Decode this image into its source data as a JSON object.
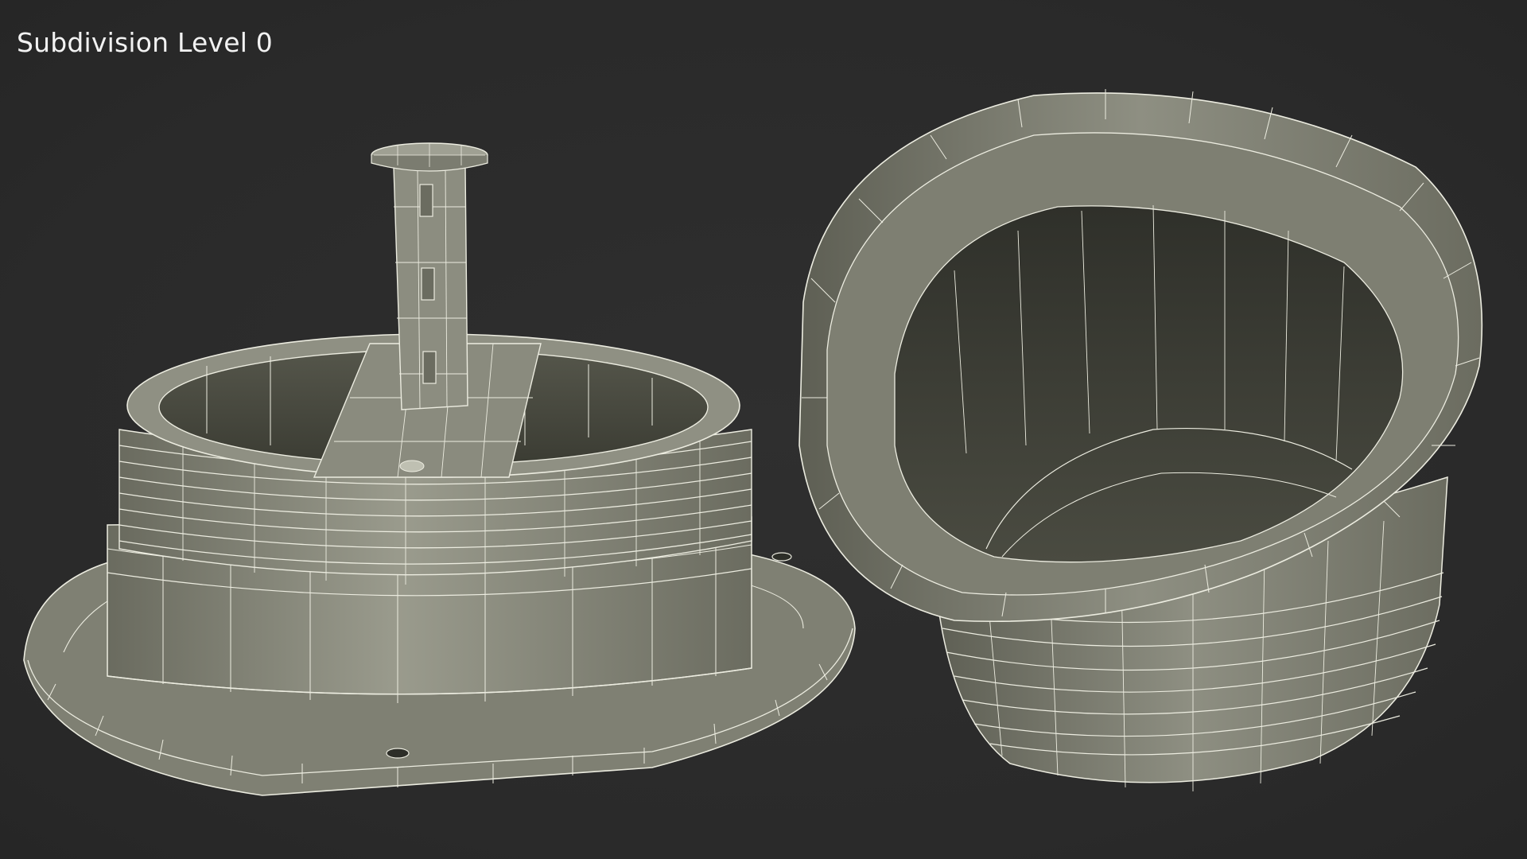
{
  "overlay": {
    "title": "Subdivision Level 0"
  },
  "scene": {
    "background_color": "#2c2c2c",
    "surface_color": "#8d8e80",
    "surface_dark_color": "#5f6054",
    "wire_color": "#ecece0",
    "objects": [
      "threaded-flange-base-with-spindle",
      "threaded-cap"
    ]
  }
}
